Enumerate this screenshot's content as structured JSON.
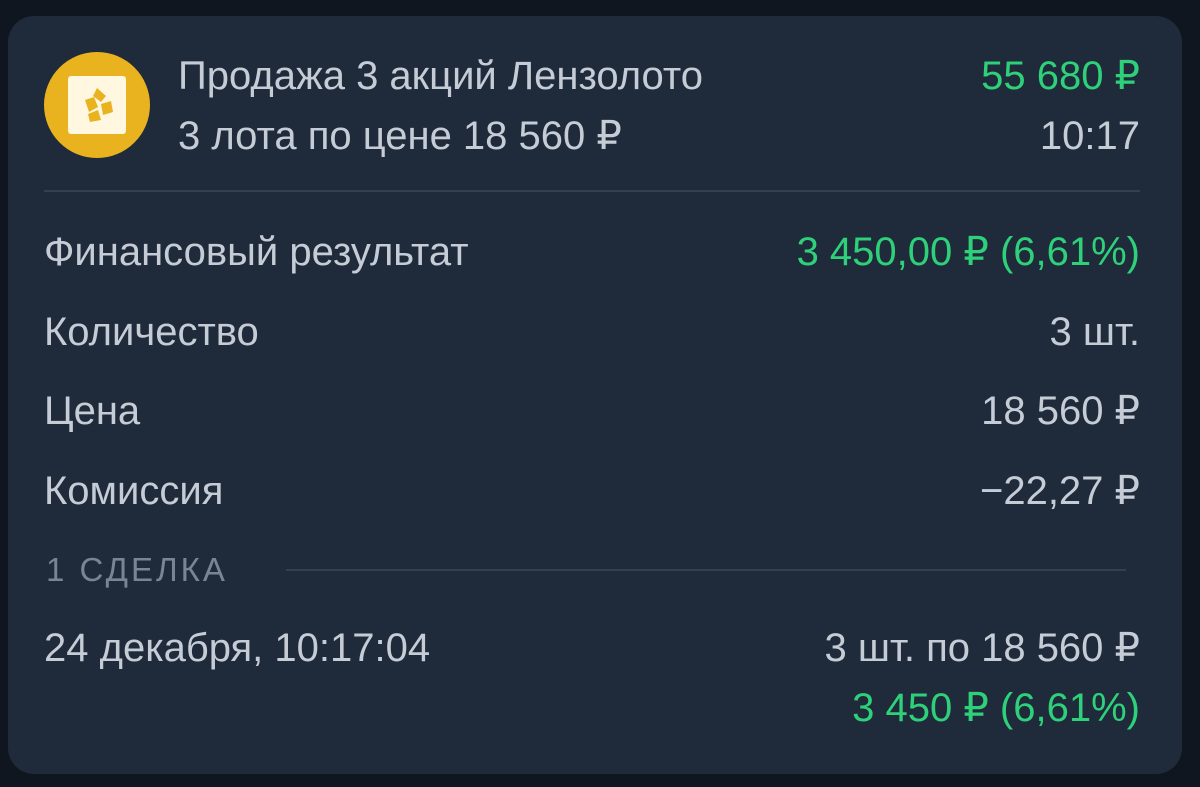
{
  "operation": {
    "title": "Продажа 3 акций Лензолото",
    "subtitle": "3 лота по цене 18 560 ₽",
    "amount": "55 680 ₽",
    "time": "10:17",
    "icon": "lenzoloto-logo-icon",
    "accent_color": "#e9b21f"
  },
  "details": [
    {
      "label": "Финансовый результат",
      "value": "3 450,00 ₽ (6,61%)"
    },
    {
      "label": "Количество",
      "value": "3 шт."
    },
    {
      "label": "Цена",
      "value": "18 560 ₽"
    },
    {
      "label": "Комиссия",
      "value": "−22,27 ₽"
    }
  ],
  "deals_section": {
    "title": "1 СДЕЛКА",
    "deals": [
      {
        "datetime": "24 декабря, 10:17:04",
        "summary": "3 шт. по 18 560 ₽",
        "result": "3 450 ₽ (6,61%)"
      }
    ]
  },
  "colors": {
    "background": "#1f2a3a",
    "positive": "#2fd07a",
    "text": "#c5ccd6"
  }
}
